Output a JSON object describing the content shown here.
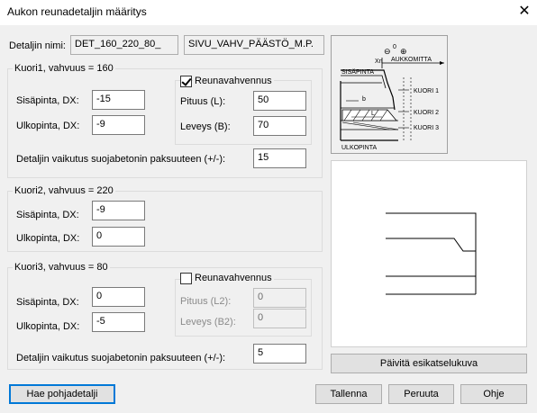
{
  "window": {
    "title": "Aukon reunadetaljin määritys",
    "close_glyph": "✕"
  },
  "detail": {
    "name_label": "Detaljin nimi:",
    "name_value": "DET_160_220_80_",
    "name_suffix": "SIVU_VAHV_PÄÄSTÖ_M.P."
  },
  "kuori1": {
    "title": "Kuori1, vahvuus = 160",
    "edge_checkbox_label": "Reunavahvennus",
    "edge_checked": true,
    "inner_label": "Sisäpinta, DX:",
    "inner_value": "-15",
    "outer_label": "Ulkopinta, DX:",
    "outer_value": "-9",
    "width_label": "Pituus (L):",
    "width_value": "50",
    "height_label": "Leveys (B):",
    "height_value": "70",
    "effect_label": "Detaljin vaikutus suojabetonin paksuuteen (+/-):",
    "effect_value": "15"
  },
  "kuori2": {
    "title": "Kuori2, vahvuus = 220",
    "inner_label": "Sisäpinta, DX:",
    "inner_value": "-9",
    "outer_label": "Ulkopinta, DX:",
    "outer_value": "0"
  },
  "kuori3": {
    "title": "Kuori3, vahvuus = 80",
    "edge_checkbox_label": "Reunavahvennus",
    "edge_checked": false,
    "inner_label": "Sisäpinta, DX:",
    "inner_value": "0",
    "outer_label": "Ulkopinta, DX:",
    "outer_value": "-5",
    "width_label": "Pituus (L2):",
    "width_value": "0",
    "height_label": "Leveys (B2):",
    "height_value": "0",
    "effect_label": "Detaljin vaikutus suojabetonin paksuuteen (+/-):",
    "effect_value": "5"
  },
  "diagram": {
    "aukkomitta": "AUKKOMITTA",
    "sisapinta": "SISÄPINTA",
    "ulkopinta": "ULKOPINTA",
    "kuori1": "KUORI 1",
    "kuori2": "KUORI 2",
    "kuori3": "KUORI 3",
    "xn": "Xn",
    "zero": "0",
    "minus": "⊖",
    "plus": "⊕",
    "b": "b",
    "l": "L"
  },
  "buttons": {
    "refresh": "Päivitä esikatselukuva",
    "fetch": "Hae pohjadetalji",
    "save": "Tallenna",
    "cancel": "Peruuta",
    "help": "Ohje"
  }
}
